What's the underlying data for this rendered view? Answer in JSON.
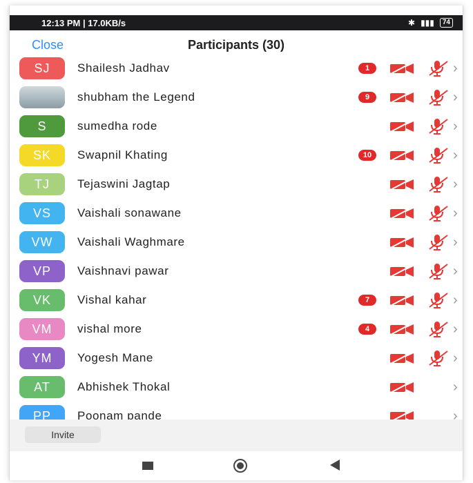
{
  "status_bar": {
    "time_speed": "12:13 PM | 17.0KB/s",
    "battery": "74"
  },
  "header": {
    "close_label": "Close",
    "title": "Participants (30)"
  },
  "participants": [
    {
      "initials": "SJ",
      "name": "Shailesh Jadhav",
      "badge": "1",
      "color": "#ee5a5a",
      "video_icon": "video-off-icon",
      "mic_icon": "mic-muted-icon"
    },
    {
      "initials": "",
      "name": "shubham the Legend",
      "badge": "9",
      "color": "#b0bec5",
      "video_icon": "video-off-icon",
      "mic_icon": "mic-muted-icon",
      "avatar": "photo"
    },
    {
      "initials": "S",
      "name": "sumedha rode",
      "badge": "",
      "color": "#4e9a3c",
      "video_icon": "video-off-icon",
      "mic_icon": "mic-muted-icon"
    },
    {
      "initials": "SK",
      "name": "Swapnil Khating",
      "badge": "10",
      "color": "#f5d928",
      "video_icon": "video-off-icon",
      "mic_icon": "mic-muted-icon"
    },
    {
      "initials": "TJ",
      "name": "Tejaswini Jagtap",
      "badge": "",
      "color": "#a9d27e",
      "video_icon": "video-off-icon",
      "mic_icon": "mic-muted-icon"
    },
    {
      "initials": "VS",
      "name": "Vaishali sonawane",
      "badge": "",
      "color": "#42b4f0",
      "video_icon": "video-off-icon",
      "mic_icon": "mic-muted-icon"
    },
    {
      "initials": "VW",
      "name": "Vaishali Waghmare",
      "badge": "",
      "color": "#42b4f0",
      "video_icon": "video-off-icon",
      "mic_icon": "mic-muted-icon"
    },
    {
      "initials": "VP",
      "name": "Vaishnavi pawar",
      "badge": "",
      "color": "#8e63c9",
      "video_icon": "video-off-icon",
      "mic_icon": "mic-muted-icon"
    },
    {
      "initials": "VK",
      "name": "Vishal kahar",
      "badge": "7",
      "color": "#67bd6b",
      "video_icon": "video-off-icon",
      "mic_icon": "mic-muted-icon"
    },
    {
      "initials": "VM",
      "name": "vishal more",
      "badge": "4",
      "color": "#e989c3",
      "video_icon": "video-off-icon",
      "mic_icon": "mic-muted-icon"
    },
    {
      "initials": "YM",
      "name": "Yogesh Mane",
      "badge": "",
      "color": "#8e63c9",
      "video_icon": "video-off-icon",
      "mic_icon": "mic-muted-icon"
    },
    {
      "initials": "AT",
      "name": "Abhishek Thokal",
      "badge": "",
      "color": "#67bd6b",
      "video_icon": "video-off-icon",
      "mic_icon": ""
    },
    {
      "initials": "PP",
      "name": "Poonam pande",
      "badge": "",
      "color": "#42a5f5",
      "video_icon": "video-off-icon",
      "mic_icon": ""
    }
  ],
  "footer": {
    "invite_label": "Invite"
  },
  "nav": {
    "recent_icon": "recent-apps-icon",
    "home_icon": "home-icon",
    "back_icon": "back-icon"
  },
  "colors": {
    "accent": "#2d8cff",
    "badge": "#e02a2a",
    "muted_red": "#e53935",
    "status_bar": "#1c1c1e"
  }
}
